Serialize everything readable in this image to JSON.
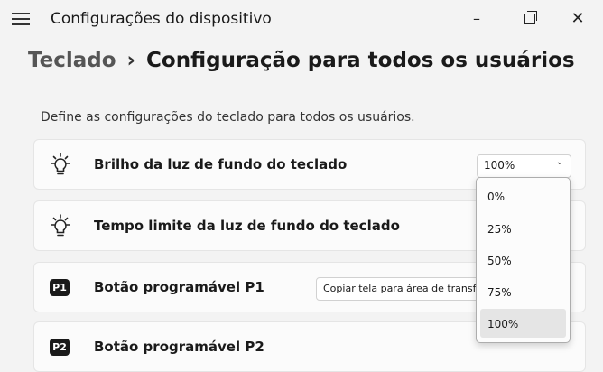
{
  "window": {
    "title": "Configurações do dispositivo",
    "minimize_glyph": "–",
    "close_glyph": "✕"
  },
  "breadcrumb": {
    "parent": "Teclado",
    "separator": "›",
    "current": "Configuração para todos os usuários"
  },
  "description": "Define as configurações do teclado para todos os usuários.",
  "settings": [
    {
      "label": "Brilho da luz de fundo do teclado",
      "icon": "lightbulb-icon",
      "value": "100%"
    },
    {
      "label": "Tempo limite da luz de fundo do teclado",
      "icon": "lightbulb-icon"
    },
    {
      "label": "Botão programável P1",
      "badge": "P1",
      "value": "Copiar tela para área de transferência"
    },
    {
      "label": "Botão programável P2",
      "badge": "P2"
    }
  ],
  "dropdown": {
    "options": [
      "0%",
      "25%",
      "50%",
      "75%",
      "100%"
    ],
    "selected": "100%"
  }
}
